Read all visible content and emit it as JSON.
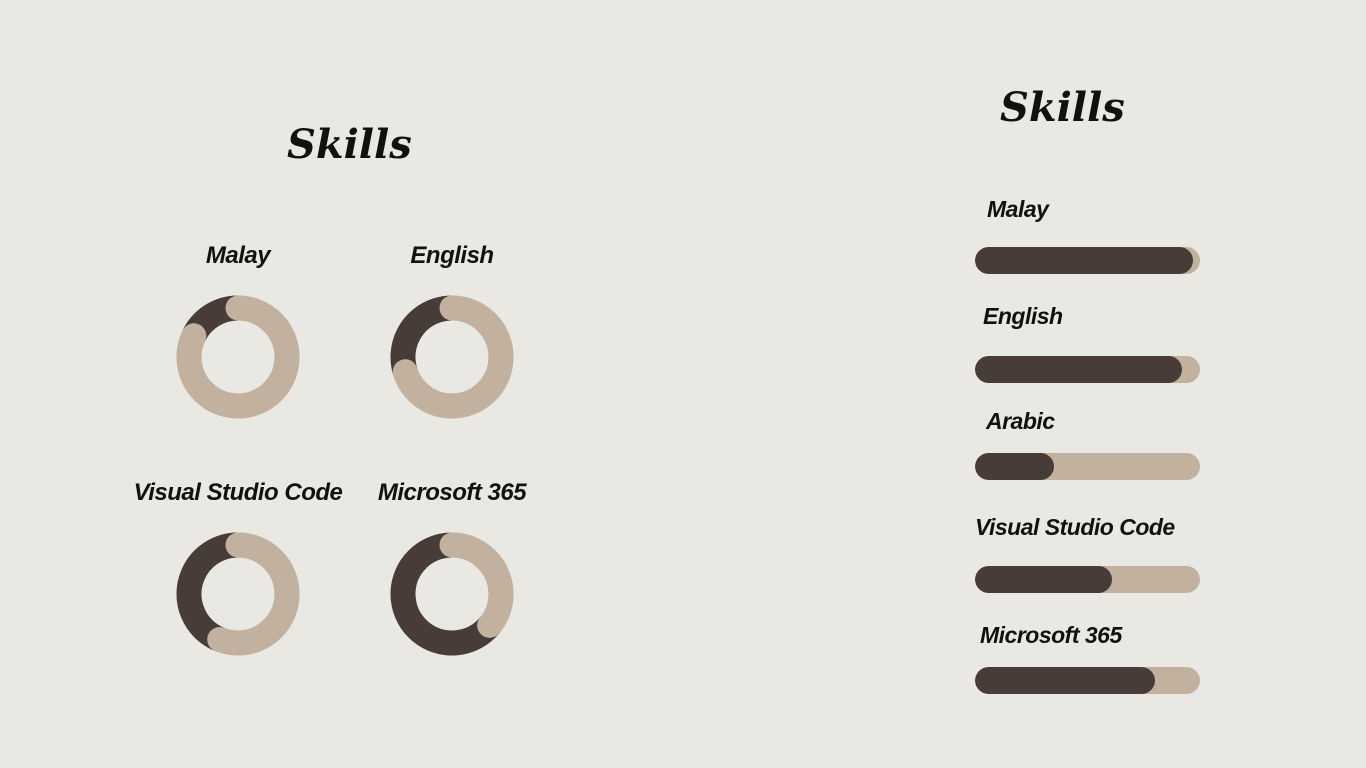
{
  "colors": {
    "background": "#e9e8e3",
    "track": "#c2b19e",
    "fill": "#473c38"
  },
  "left_panel": {
    "title": "Skills",
    "donuts": [
      {
        "label": "Malay",
        "value": 0.82
      },
      {
        "label": "English",
        "value": 0.7
      },
      {
        "label": "Visual Studio Code",
        "value": 0.56
      },
      {
        "label": "Microsoft 365",
        "value": 0.36
      }
    ]
  },
  "right_panel": {
    "title": "Skills",
    "bars": [
      {
        "label": "Malay",
        "value": 0.97
      },
      {
        "label": "English",
        "value": 0.92
      },
      {
        "label": "Arabic",
        "value": 0.35
      },
      {
        "label": "Visual Studio Code",
        "value": 0.61
      },
      {
        "label": "Microsoft 365",
        "value": 0.8
      }
    ]
  }
}
